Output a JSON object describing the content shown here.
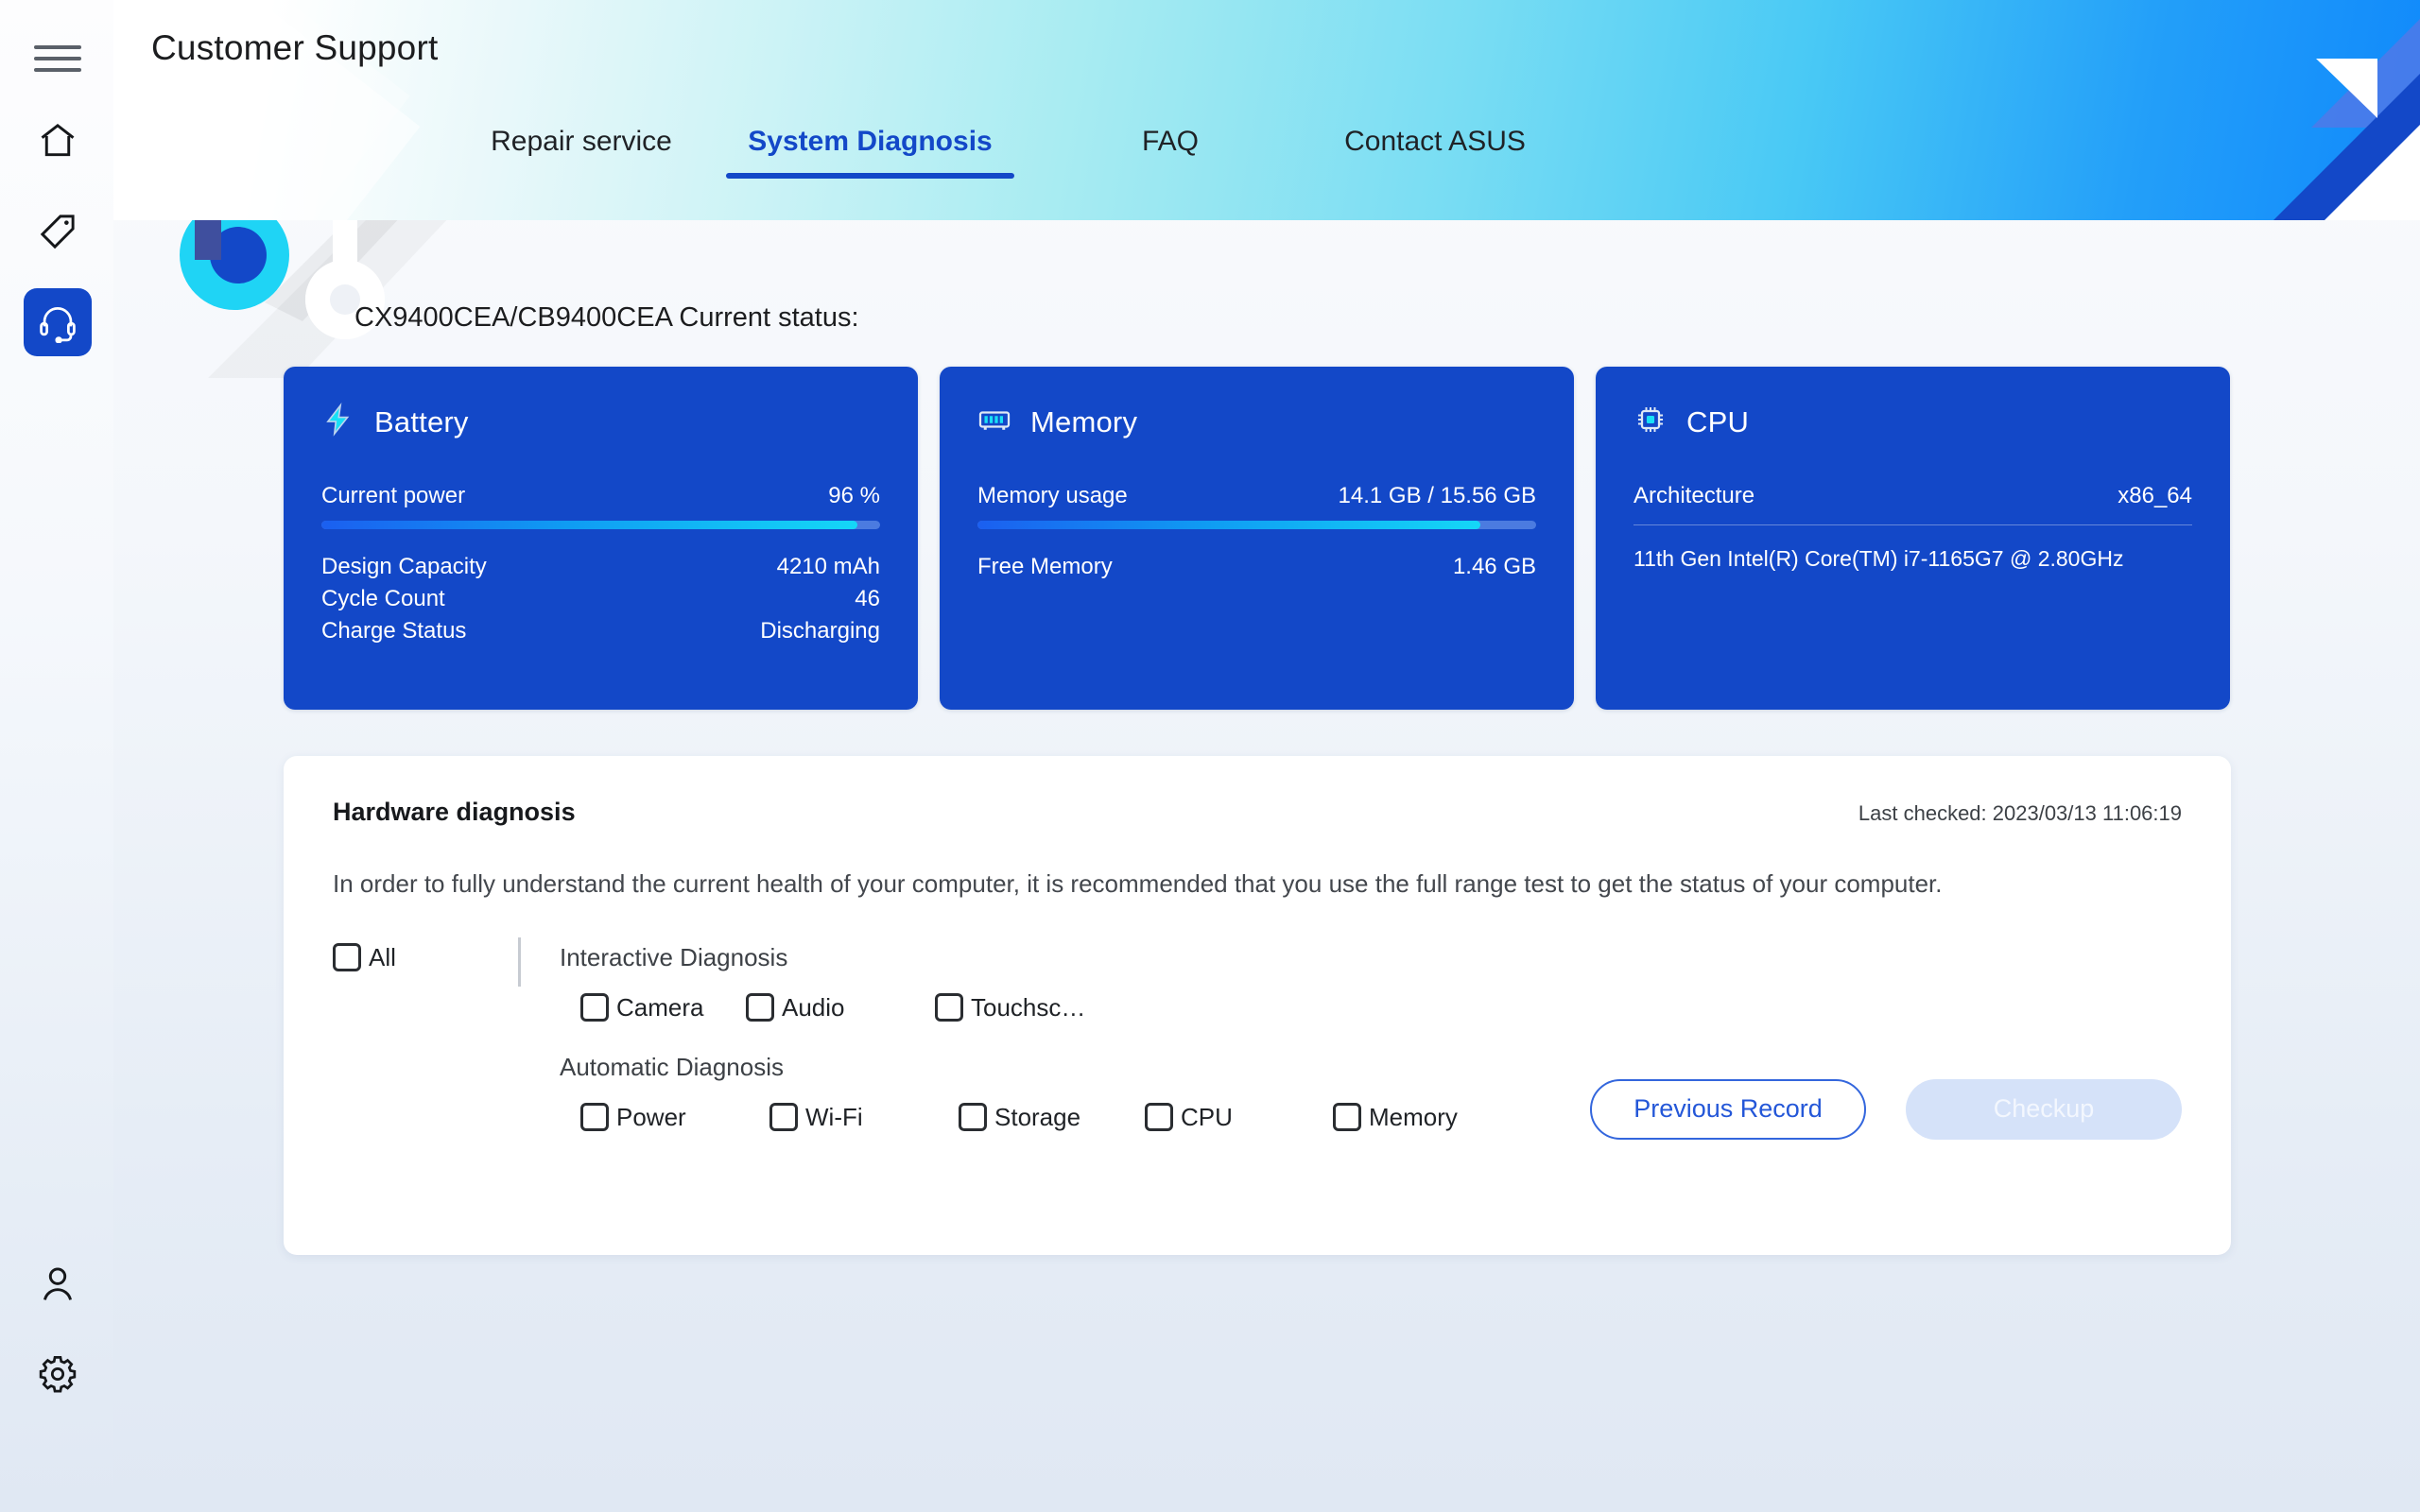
{
  "app": {
    "title": "Customer Support",
    "menu_icon": "hamburger-icon"
  },
  "sidebar": {
    "items": [
      {
        "icon": "home-icon",
        "name": "home",
        "active": false
      },
      {
        "icon": "tag-icon",
        "name": "tag",
        "active": false
      },
      {
        "icon": "headset-icon",
        "name": "support",
        "active": true
      }
    ],
    "bottom_items": [
      {
        "icon": "user-icon",
        "name": "account"
      },
      {
        "icon": "gear-icon",
        "name": "settings"
      }
    ]
  },
  "tabs": [
    {
      "label": "Repair service",
      "active": false
    },
    {
      "label": "System Diagnosis",
      "active": true
    },
    {
      "label": "FAQ",
      "active": false
    },
    {
      "label": "Contact ASUS",
      "active": false
    }
  ],
  "status_line": "CX9400CEA/CB9400CEA Current status:",
  "cards": {
    "battery": {
      "icon": "bolt-icon",
      "title": "Battery",
      "usage_label": "Current power",
      "usage_value": "96 %",
      "usage_percent": 96,
      "rows": [
        {
          "label": "Design Capacity",
          "value": "4210 mAh"
        },
        {
          "label": "Cycle Count",
          "value": "46"
        },
        {
          "label": "Charge Status",
          "value": "Discharging"
        }
      ]
    },
    "memory": {
      "icon": "ram-icon",
      "title": "Memory",
      "usage_label": "Memory usage",
      "usage_value": "14.1 GB / 15.56 GB",
      "usage_percent": 90,
      "rows": [
        {
          "label": "Free Memory",
          "value": "1.46 GB"
        }
      ]
    },
    "cpu": {
      "icon": "chip-icon",
      "title": "CPU",
      "arch_label": "Architecture",
      "arch_value": "x86_64",
      "model": "11th Gen Intel(R) Core(TM) i7-1165G7 @ 2.80GHz"
    }
  },
  "diagnosis": {
    "title": "Hardware diagnosis",
    "last_checked": "Last checked: 2023/03/13 11:06:19",
    "description": "In order to fully understand the current health of your computer, it is recommended that you use the full range test to get the status of your computer.",
    "all_label": "All",
    "interactive_title": "Interactive Diagnosis",
    "interactive_options": [
      "Camera",
      "Audio",
      "Touchsc…"
    ],
    "automatic_title": "Automatic Diagnosis",
    "automatic_options": [
      "Power",
      "Wi-Fi",
      "Storage",
      "CPU",
      "Memory"
    ],
    "previous_record_label": "Previous Record",
    "checkup_label": "Checkup"
  },
  "colors": {
    "accent": "#1348c8",
    "card_bg": "#1348c8",
    "bar_start": "#1b5ff0",
    "bar_end": "#14d7f7",
    "outline_btn": "#2457d8",
    "disabled_btn": "#d5e2f9"
  }
}
